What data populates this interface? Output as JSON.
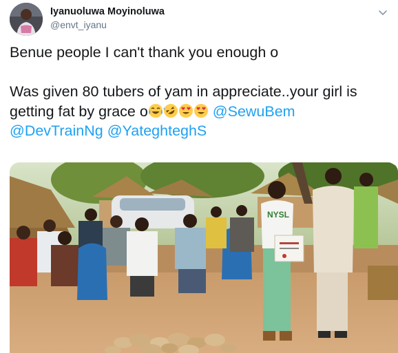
{
  "author": {
    "display_name": "Iyanuoluwa Moyinoluwa",
    "handle": "@envt_iyanu"
  },
  "tweet": {
    "line1": "Benue people I can't thank you enough o",
    "line2": "Was given 80 tubers of yam in appreciate..your girl is",
    "line3_prefix": "getting fat by grace o",
    "emojis": [
      "face-with-tears-of-joy",
      "rolling-on-floor-laughing",
      "heart-eyes",
      "heart-eyes"
    ],
    "mentions": [
      "@SewuBem",
      "@DevTrainNg",
      "@YateghteghS"
    ]
  },
  "media": {
    "shirt_text": "NYSL"
  },
  "colors": {
    "link": "#1da1f2",
    "text": "#14171a",
    "secondary": "#657786"
  }
}
